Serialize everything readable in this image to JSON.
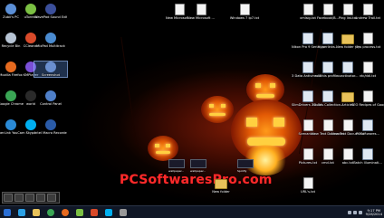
{
  "desktop": {
    "icons_left": [
      {
        "label": "Zubii's PC",
        "color": "#5b8fd6"
      },
      {
        "label": "uTorrent",
        "color": "#7bc043"
      },
      {
        "label": "WavePad Sound Editor",
        "color": "#3b4f9a"
      },
      {
        "label": "Recycle Bin",
        "color": "#b7c4d4"
      },
      {
        "label": "CCleaner",
        "color": "#d94a2a"
      },
      {
        "label": "MixPad Multitrack",
        "color": "#4a8bd0"
      },
      {
        "label": "Mozilla Firefox",
        "color": "#e66a1f"
      },
      {
        "label": "KMPlayer",
        "color": "#7a4fd6"
      },
      {
        "label": "Screenshot",
        "color": "#6a8fd0"
      },
      {
        "label": "Google Chrome",
        "color": "#3aa655"
      },
      {
        "label": "world",
        "color": "#2a2a2a"
      },
      {
        "label": "Control Panel",
        "color": "#4f7fc8"
      },
      {
        "label": "CyberLink YouCam 5",
        "color": "#2a8ad6"
      },
      {
        "label": "Skype",
        "color": "#00aff0"
      },
      {
        "label": "Intel Macro Recorder",
        "color": "#2a5ba8"
      }
    ],
    "icons_top_middle": [
      {
        "label": "New Microsoft ...",
        "kind": "doc"
      },
      {
        "label": "New Microsoft ...",
        "kind": "doc"
      },
      {
        "label": "Windows 7 Ip7.txt",
        "kind": "doc"
      }
    ],
    "icons_right": [
      {
        "label": "xmlsig.txt",
        "kind": "doc"
      },
      {
        "label": "Facebook/B...",
        "kind": "doc"
      },
      {
        "label": "Ping list.txt",
        "kind": "doc"
      },
      {
        "label": "Andrew Trail.txt",
        "kind": "doc"
      },
      {
        "label": "Nikon Pro 9 Serial keys...",
        "kind": "file"
      },
      {
        "label": "Hyperlinks...",
        "kind": "file"
      },
      {
        "label": "New folder (3)",
        "kind": "folder"
      },
      {
        "label": "new process.txt",
        "kind": "doc"
      },
      {
        "label": "3 Data Antivirus 2...",
        "kind": "file"
      },
      {
        "label": "addthis profile...",
        "kind": "file"
      },
      {
        "label": "ccactivator...",
        "kind": "file"
      },
      {
        "label": "vtc/ddl.txt",
        "kind": "doc"
      },
      {
        "label": "SlimDrivers 2.2.34...",
        "kind": "file"
      },
      {
        "label": "Movies Collection...",
        "kind": "file"
      },
      {
        "label": "Articles",
        "kind": "folder"
      },
      {
        "label": "SEO Recipes of Google...",
        "kind": "doc"
      },
      {
        "label": "Scenarios...",
        "kind": "doc"
      },
      {
        "label": "New Text Document...",
        "kind": "doc"
      },
      {
        "label": "New Text Document...",
        "kind": "doc"
      },
      {
        "label": "PCSoftwares...",
        "kind": "file"
      },
      {
        "label": "Pictures.txt",
        "kind": "doc"
      },
      {
        "label": "cmd.txt",
        "kind": "doc"
      },
      {
        "label": "abc.txt",
        "kind": "doc"
      },
      {
        "label": "Batch Illuminati...",
        "kind": "file"
      },
      {
        "label": "URL's.txt",
        "kind": "doc"
      }
    ],
    "bottom_middle": [
      {
        "label": "wallpaper...",
        "kind": "thumb"
      },
      {
        "label": "wallpaper...",
        "kind": "thumb"
      },
      {
        "label": "New folder",
        "kind": "folder"
      },
      {
        "label": "Spotify",
        "kind": "thumb"
      }
    ]
  },
  "watermark": "PCSoftwaresPro.com",
  "taskbar": {
    "buttons": [
      {
        "name": "start",
        "color": "#2a6fd6"
      },
      {
        "name": "ie",
        "color": "#2aa0e6"
      },
      {
        "name": "folder",
        "color": "#e8c25a"
      },
      {
        "name": "chrome",
        "color": "#3aa655"
      },
      {
        "name": "firefox",
        "color": "#e66a1f"
      },
      {
        "name": "utorrent",
        "color": "#7bc043"
      },
      {
        "name": "media",
        "color": "#d94a2a"
      },
      {
        "name": "skype",
        "color": "#00aff0"
      },
      {
        "name": "other",
        "color": "#999"
      }
    ],
    "clock_time": "9:17 PM",
    "clock_date": "9/28/2014"
  }
}
